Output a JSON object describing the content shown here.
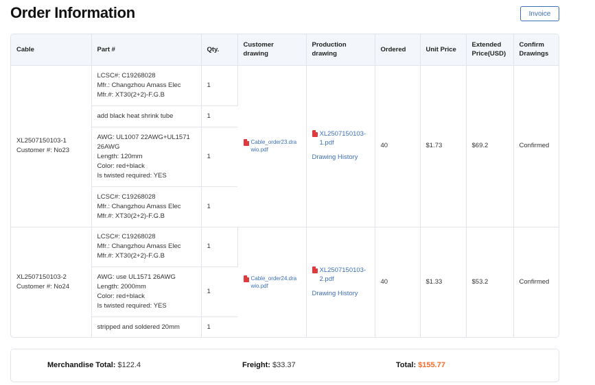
{
  "page": {
    "title": "Order Information",
    "invoice_label": "Invoice"
  },
  "table": {
    "headers": {
      "cable": "Cable",
      "part": "Part #",
      "qty": "Qty.",
      "customer_drawing": "Customer drawing",
      "production_drawing": "Production drawing",
      "ordered": "Ordered",
      "unit_price": "Unit Price",
      "extended_price": "Extended Price(USD)",
      "confirm": "Confirm Drawings"
    },
    "orders": [
      {
        "cable": "XL2507150103-1\nCustomer #: No23",
        "parts": [
          {
            "desc": "LCSC#: C19268028\nMfr.: Changzhou Amass Elec\nMfr.#: XT30(2+2)-F.G.B",
            "qty": "1"
          },
          {
            "desc": "add black heat shrink tube",
            "qty": "1"
          },
          {
            "desc": "AWG: UL1007 22AWG+UL1571 26AWG\nLength: 120mm\nColor: red+black\nIs twisted required: YES",
            "qty": "1"
          },
          {
            "desc": "LCSC#: C19268028\nMfr.: Changzhou Amass Elec\nMfr.#: XT30(2+2)-F.G.B",
            "qty": "1"
          }
        ],
        "customer_drawing": "Cable_order23.drawio.pdf",
        "production_drawing": "XL2507150103-1.pdf",
        "drawing_history": "Drawing History",
        "ordered": "40",
        "unit_price": "$1.73",
        "extended_price": "$69.2",
        "confirm": "Confirmed"
      },
      {
        "cable": "XL2507150103-2\nCustomer #: No24",
        "parts": [
          {
            "desc": "LCSC#: C19268028\nMfr.: Changzhou Amass Elec\nMfr.#: XT30(2+2)-F.G.B",
            "qty": "1"
          },
          {
            "desc": "AWG: use UL1571 26AWG\nLength: 2000mm\nColor: red+black\nIs twisted required: YES",
            "qty": "1"
          },
          {
            "desc": "stripped and soldered 20mm",
            "qty": "1"
          }
        ],
        "customer_drawing": "Cable_order24.drawio.pdf",
        "production_drawing": "XL2507150103-2.pdf",
        "drawing_history": "Drawing History",
        "ordered": "40",
        "unit_price": "$1.33",
        "extended_price": "$53.2",
        "confirm": "Confirmed"
      }
    ]
  },
  "totals": {
    "merchandise_label": "Merchandise Total:",
    "merchandise_value": "$122.4",
    "freight_label": "Freight:",
    "freight_value": "$33.37",
    "total_label": "Total:",
    "total_value": "$155.77"
  },
  "colors": {
    "accent": "#3b6fb6",
    "total": "#f26b2a",
    "pdf_icon": "#e0393e"
  },
  "icons": {
    "pdf": "pdf-file-icon"
  }
}
